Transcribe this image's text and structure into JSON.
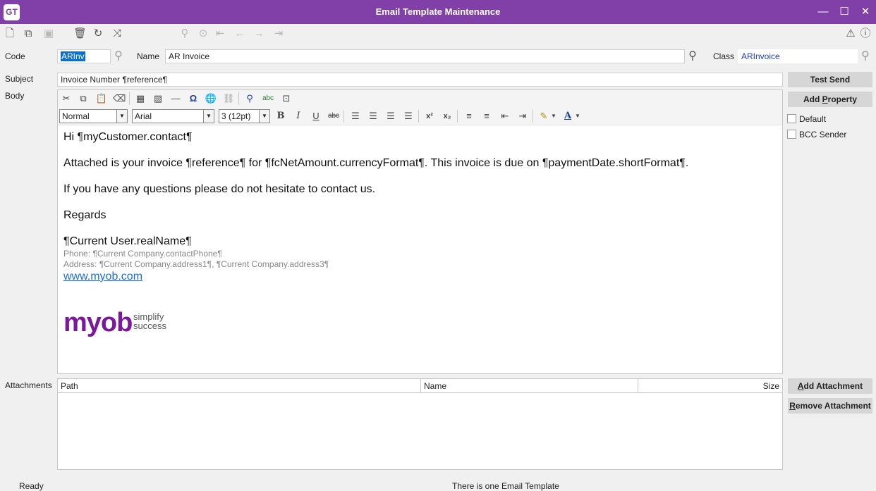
{
  "window": {
    "logo": "GT",
    "title": "Email Template Maintenance",
    "min_glyph": "—",
    "max_glyph": "☐",
    "close_glyph": "✕"
  },
  "toolbar": {
    "icons": [
      "new-document-icon",
      "copy-document-icon",
      "save-icon",
      "delete-icon",
      "refresh-icon",
      "merge-icon",
      "find-icon",
      "go-to-icon",
      "first-record-icon",
      "previous-record-icon",
      "next-record-icon",
      "last-record-icon",
      "alert-icon",
      "help-icon"
    ]
  },
  "form": {
    "code_label": "Code",
    "code_value": "ARInv",
    "name_label": "Name",
    "name_value": "AR Invoice",
    "class_label": "Class",
    "class_value": "ARInvoice",
    "subject_label": "Subject",
    "subject_value": "Invoice Number ¶reference¶",
    "body_label": "Body",
    "attachments_label": "Attachments"
  },
  "buttons": {
    "test_send": "Test Send",
    "add_property_prefix": "Add ",
    "add_property_hot": "P",
    "add_property_suffix": "roperty",
    "add_attachment_prefix": "",
    "add_attachment_hot": "A",
    "add_attachment_suffix": "dd Attachment",
    "remove_attachment_prefix": "",
    "remove_attachment_hot": "R",
    "remove_attachment_suffix": "emove Attachment"
  },
  "options": {
    "default_label": "Default",
    "default_checked": false,
    "bcc_label": "BCC Sender",
    "bcc_checked": false
  },
  "editor": {
    "style_value": "Normal",
    "font_value": "Arial",
    "size_value": "3 (12pt)",
    "bold_glyph": "B",
    "italic_glyph": "I",
    "underline_glyph": "U",
    "strike_glyph": "abc",
    "superscript_glyph": "x²",
    "subscript_glyph": "x₂",
    "font_color_glyph": "A",
    "body": {
      "greeting": "Hi ¶myCustomer.contact¶",
      "line1": "Attached is your invoice ¶reference¶ for ¶fcNetAmount.currencyFormat¶.  This invoice is due on ¶paymentDate.shortFormat¶.",
      "line2": "If you have any questions please do not hesitate to contact us.",
      "regards": "Regards",
      "signature_name": "¶Current User.realName¶",
      "phone": "Phone: ¶Current Company.contactPhone¶",
      "address": "Address: ¶Current Company.address1¶, ¶Current Company.address3¶",
      "website": "www.myob.com",
      "logo_word": "myob",
      "logo_tag1": "simplify",
      "logo_tag2": "success"
    }
  },
  "attachments": {
    "columns": [
      "Path",
      "Name",
      "Size"
    ],
    "rows": []
  },
  "status": {
    "left": "Ready",
    "center": "There is one Email Template"
  },
  "colors": {
    "title_bar": "#8040a8",
    "link": "#1a6fd6",
    "class_value": "#1f3fb5"
  }
}
